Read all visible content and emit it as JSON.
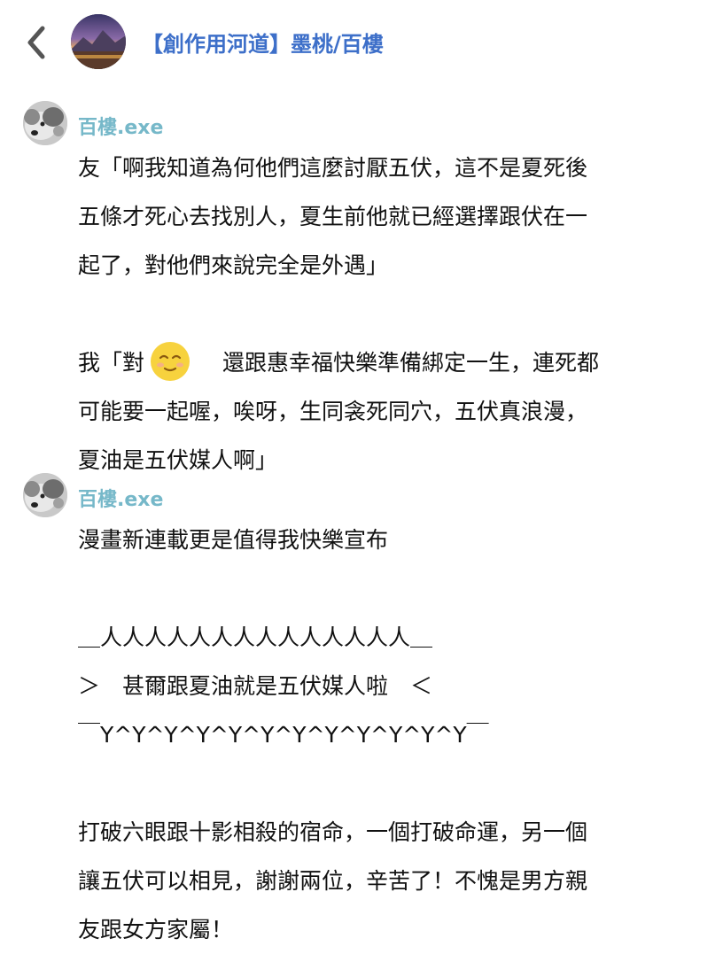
{
  "header": {
    "back_icon": "chevron-left-icon",
    "channel_title": "【創作用河道】墨桃/百樓"
  },
  "messages": [
    {
      "username": "百樓.exe",
      "lines": [
        "友「啊我知道為何他們這麼討厭五伏，這不是夏死後",
        "五條才死心去找別人，夏生前他就已經選擇跟伏在一",
        "起了，對他們來說完全是外遇」",
        "",
        "我「對",
        "可能要一起喔，唉呀，生同衾死同穴，五伏真浪漫，",
        "夏油是五伏媒人啊」"
      ],
      "emoji_line_rest": "還跟惠幸福快樂準備綁定一生，連死都",
      "emoji": "relieved-face-emoji"
    },
    {
      "username": "百樓.exe",
      "lines": [
        "漫畫新連載更是值得我快樂宣布",
        "",
        "＿人人人人人人人人人人人人人人＿",
        "＞　甚爾跟夏油就是五伏媒人啦　＜",
        "￣Y^Y^Y^Y^Y^Y^Y^Y^Y^Y^Y^Y￣",
        "",
        "打破六眼跟十影相殺的宿命，一個打破命運，另一個",
        "讓五伏可以相見，謝謝兩位，辛苦了！不愧是男方親",
        "友跟女方家屬！"
      ]
    }
  ],
  "colors": {
    "channel_title": "#3d6fc9",
    "username": "#76b8c9",
    "text": "#111111"
  }
}
